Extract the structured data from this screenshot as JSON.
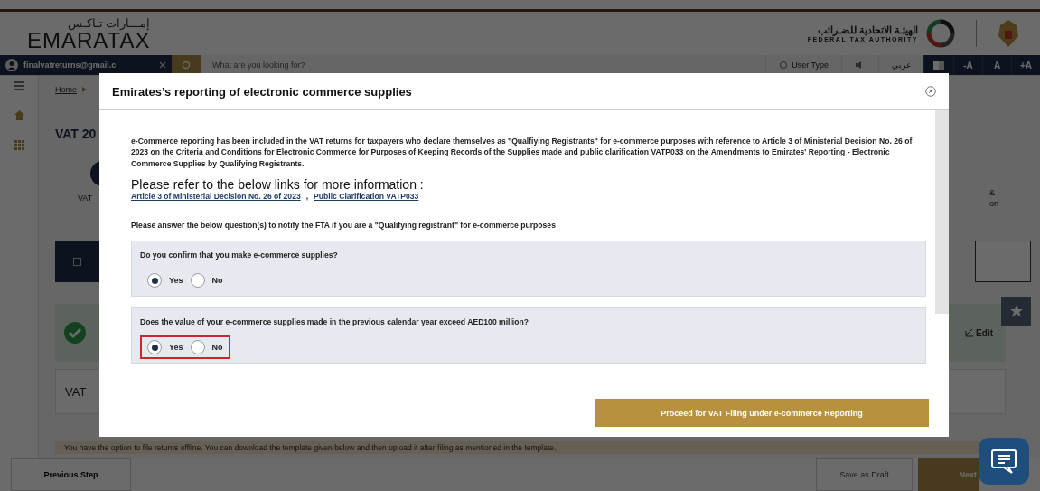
{
  "header": {
    "logo_arabic": "إمـــارات تـاكـس",
    "logo_text": "EMARATAX",
    "authority_arabic": "الهيئـة الاتحادية للضـرائب",
    "authority_english": "FEDERAL TAX AUTHORITY"
  },
  "nav": {
    "email": "finalvatreturns@gmail.c",
    "search": {
      "placeholder": "What are you looking for?"
    },
    "user_type": "User Type",
    "language": "عربي",
    "font_controls": [
      "-A",
      "A",
      "+A"
    ]
  },
  "breadcrumb": [
    "Home"
  ],
  "page": {
    "title": "VAT 20",
    "step_label": "VAT",
    "step_right_lines": [
      "&",
      "on"
    ],
    "edit": "Edit",
    "section_title": "VAT",
    "offline_note": "You have the option to file returns offline. You can download the template given below and then upload it after filing as mentioned in the template."
  },
  "footer": {
    "previous": "Previous Step",
    "save": "Save as Draft",
    "next": "Next"
  },
  "modal": {
    "title": "Emirates’s reporting of electronic commerce supplies",
    "intro": "e-Commerce reporting has been included in the VAT returns for taxpayers who declare themselves as \"Qualfiying Registrants\" for e-commerce purposes with reference to Article 3 of Ministerial Decision No. 26 of 2023 on the Criteria and Conditions for Electronic Commerce for Purposes of Keeping Records of the Supplies made and public clarification VATP033 on the Amendments to Emirates' Reporting - Electronic Commerce Supplies by Qualifying Registrants.",
    "links_heading": "Please refer to the below links for more information :",
    "links": [
      "Article 3 of Ministerial Decision No. 26 of 2023",
      "Public Clarification VATP033"
    ],
    "link_separator": ",",
    "instruction": "Please answer the below question(s) to notify the FTA if you are a \"Qualifying registrant\" for e-commerce purposes",
    "questions": [
      {
        "text": "Do you confirm that you make e-commerce supplies?",
        "highlighted": false,
        "options": [
          {
            "label": "Yes",
            "selected": true
          },
          {
            "label": "No",
            "selected": false
          }
        ]
      },
      {
        "text": "Does the value of your e-commerce supplies made in the previous calendar year exceed AED100 million?",
        "highlighted": true,
        "options": [
          {
            "label": "Yes",
            "selected": true
          },
          {
            "label": "No",
            "selected": false
          }
        ]
      }
    ],
    "proceed_button": "Proceed for VAT Filing under e-commerce Reporting"
  }
}
